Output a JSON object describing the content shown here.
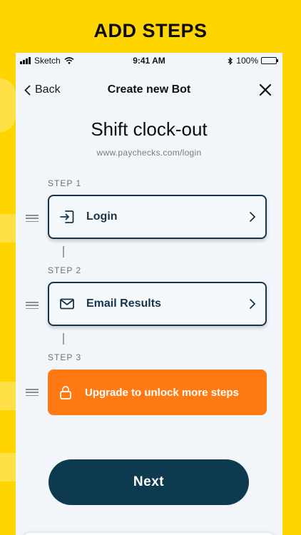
{
  "headline": "ADD STEPS",
  "status_bar": {
    "carrier": "Sketch",
    "time": "9:41 AM",
    "battery": "100%",
    "battery_level": 1.0
  },
  "nav": {
    "back_label": "Back",
    "title": "Create new Bot",
    "close_icon": "close-icon"
  },
  "bot": {
    "name": "Shift clock-out",
    "url": "www.paychecks.com/login"
  },
  "steps": [
    {
      "label": "STEP 1",
      "title": "Login",
      "icon": "login-icon"
    },
    {
      "label": "STEP 2",
      "title": "Email Results",
      "icon": "envelope-icon"
    },
    {
      "label": "STEP 3",
      "title": "Upgrade to unlock more steps",
      "icon": "lock-icon"
    }
  ],
  "next_label": "Next",
  "colors": {
    "background": "#FFD500",
    "primary": "#0E3A50",
    "accent": "#FF7A12",
    "card_border": "#17344A"
  }
}
